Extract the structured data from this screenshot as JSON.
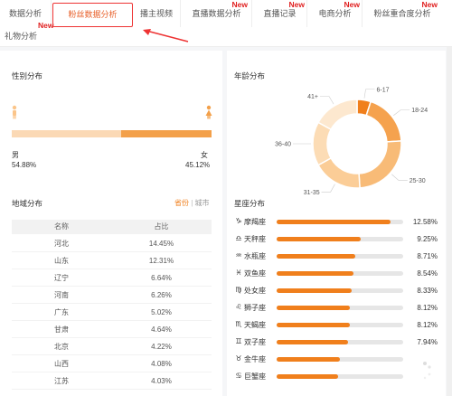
{
  "tabs": [
    {
      "label": "数据分析",
      "new": ""
    },
    {
      "label": "粉丝数据分析",
      "new": "New",
      "active": true
    },
    {
      "label": "播主视频",
      "new": ""
    },
    {
      "label": "直播数据分析",
      "new": "New"
    },
    {
      "label": "直播记录",
      "new": "New"
    },
    {
      "label": "电商分析",
      "new": "New"
    },
    {
      "label": "粉丝重合度分析",
      "new": "New"
    }
  ],
  "tab_row2": {
    "label": "礼物分析"
  },
  "gender": {
    "title": "性别分布",
    "male_label": "男",
    "male_pct": "54.88%",
    "male_value": 54.88,
    "female_label": "女",
    "female_pct": "45.12%",
    "female_value": 45.12
  },
  "age": {
    "title": "年龄分布",
    "segments": [
      {
        "label": "6-17",
        "value": 5
      },
      {
        "label": "18-24",
        "value": 19
      },
      {
        "label": "25-30",
        "value": 25
      },
      {
        "label": "31-35",
        "value": 18
      },
      {
        "label": "36-40",
        "value": 16
      },
      {
        "label": "41+",
        "value": 17
      }
    ]
  },
  "region": {
    "title": "地域分布",
    "toggle_province": "省份",
    "toggle_divider": "|",
    "toggle_city": "城市",
    "col_name": "名称",
    "col_pct": "占比",
    "rows": [
      {
        "name": "河北",
        "pct": "14.45%"
      },
      {
        "name": "山东",
        "pct": "12.31%"
      },
      {
        "name": "辽宁",
        "pct": "6.64%"
      },
      {
        "name": "河南",
        "pct": "6.26%"
      },
      {
        "name": "广东",
        "pct": "5.02%"
      },
      {
        "name": "甘肃",
        "pct": "4.64%"
      },
      {
        "name": "北京",
        "pct": "4.22%"
      },
      {
        "name": "山西",
        "pct": "4.08%"
      },
      {
        "name": "江苏",
        "pct": "4.03%"
      }
    ]
  },
  "zodiac": {
    "title": "星座分布",
    "rows": [
      {
        "icon": "♑",
        "name": "摩羯座",
        "pct": "12.58%",
        "value": 12.58
      },
      {
        "icon": "♎",
        "name": "天秤座",
        "pct": "9.25%",
        "value": 9.25
      },
      {
        "icon": "♒",
        "name": "水瓶座",
        "pct": "8.71%",
        "value": 8.71
      },
      {
        "icon": "♓",
        "name": "双鱼座",
        "pct": "8.54%",
        "value": 8.54
      },
      {
        "icon": "♍",
        "name": "处女座",
        "pct": "8.33%",
        "value": 8.33
      },
      {
        "icon": "♌",
        "name": "狮子座",
        "pct": "8.12%",
        "value": 8.12
      },
      {
        "icon": "♏",
        "name": "天蝎座",
        "pct": "8.12%",
        "value": 8.12
      },
      {
        "icon": "♊",
        "name": "双子座",
        "pct": "7.94%",
        "value": 7.94
      },
      {
        "icon": "♉",
        "name": "金牛座",
        "pct": "",
        "value": 7.0
      },
      {
        "icon": "♋",
        "name": "巨蟹座",
        "pct": "",
        "value": 6.8
      }
    ]
  },
  "colors": {
    "accent": "#f07f1c",
    "accent_light": "#fbd9b5",
    "active_tab_border": "#e33333",
    "new_badge": "#e02020"
  },
  "chart_data": [
    {
      "type": "bar",
      "title": "性别分布",
      "categories": [
        "男",
        "女"
      ],
      "values": [
        54.88,
        45.12
      ]
    },
    {
      "type": "pie",
      "title": "年龄分布",
      "categories": [
        "6-17",
        "18-24",
        "25-30",
        "31-35",
        "36-40",
        "41+"
      ],
      "values": [
        5,
        19,
        25,
        18,
        16,
        17
      ]
    },
    {
      "type": "table",
      "title": "地域分布",
      "columns": [
        "名称",
        "占比"
      ],
      "rows": [
        [
          "河北",
          "14.45%"
        ],
        [
          "山东",
          "12.31%"
        ],
        [
          "辽宁",
          "6.64%"
        ],
        [
          "河南",
          "6.26%"
        ],
        [
          "广东",
          "5.02%"
        ],
        [
          "甘肃",
          "4.64%"
        ],
        [
          "北京",
          "4.22%"
        ],
        [
          "山西",
          "4.08%"
        ],
        [
          "江苏",
          "4.03%"
        ]
      ]
    },
    {
      "type": "bar",
      "title": "星座分布",
      "categories": [
        "摩羯座",
        "天秤座",
        "水瓶座",
        "双鱼座",
        "处女座",
        "狮子座",
        "天蝎座",
        "双子座",
        "金牛座",
        "巨蟹座"
      ],
      "values": [
        12.58,
        9.25,
        8.71,
        8.54,
        8.33,
        8.12,
        8.12,
        7.94,
        7.0,
        6.8
      ]
    }
  ]
}
